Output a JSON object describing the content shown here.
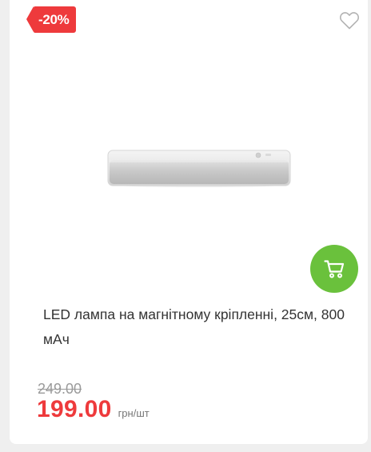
{
  "product": {
    "discount_badge": "-20%",
    "title": "LED лампа на магнітному кріпленні, 25см, 800 мАч",
    "old_price": "249.00",
    "price": "199.00",
    "unit": "грн/шт"
  },
  "icons": {
    "favorite": "heart-outline-icon",
    "cart": "shopping-cart-icon"
  },
  "colors": {
    "discount": "#ee3a3c",
    "price": "#ee3a3c",
    "cart_button": "#6ac13c"
  }
}
